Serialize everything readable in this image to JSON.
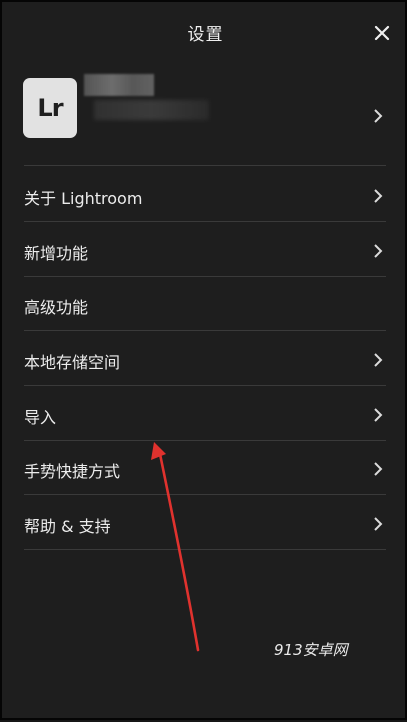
{
  "header": {
    "title": "设置",
    "close_icon": "close-icon"
  },
  "account": {
    "logo_text": "Lr",
    "name_blurred": true
  },
  "menu": {
    "items": [
      {
        "label": "关于 Lightroom",
        "has_chevron": true
      },
      {
        "label": "新增功能",
        "has_chevron": true
      },
      {
        "label": "高级功能",
        "has_chevron": false
      },
      {
        "label": "本地存储空间",
        "has_chevron": true
      },
      {
        "label": "导入",
        "has_chevron": true
      },
      {
        "label": "手势快捷方式",
        "has_chevron": true
      },
      {
        "label": "帮助 & 支持",
        "has_chevron": true
      }
    ]
  },
  "annotation": {
    "arrow_color": "#e0322e"
  },
  "watermark": "913安卓网",
  "colors": {
    "background": "#1e1e1e",
    "divider": "#3a3a3a",
    "text": "#ececec",
    "logo_bg": "#e2e2e2"
  }
}
